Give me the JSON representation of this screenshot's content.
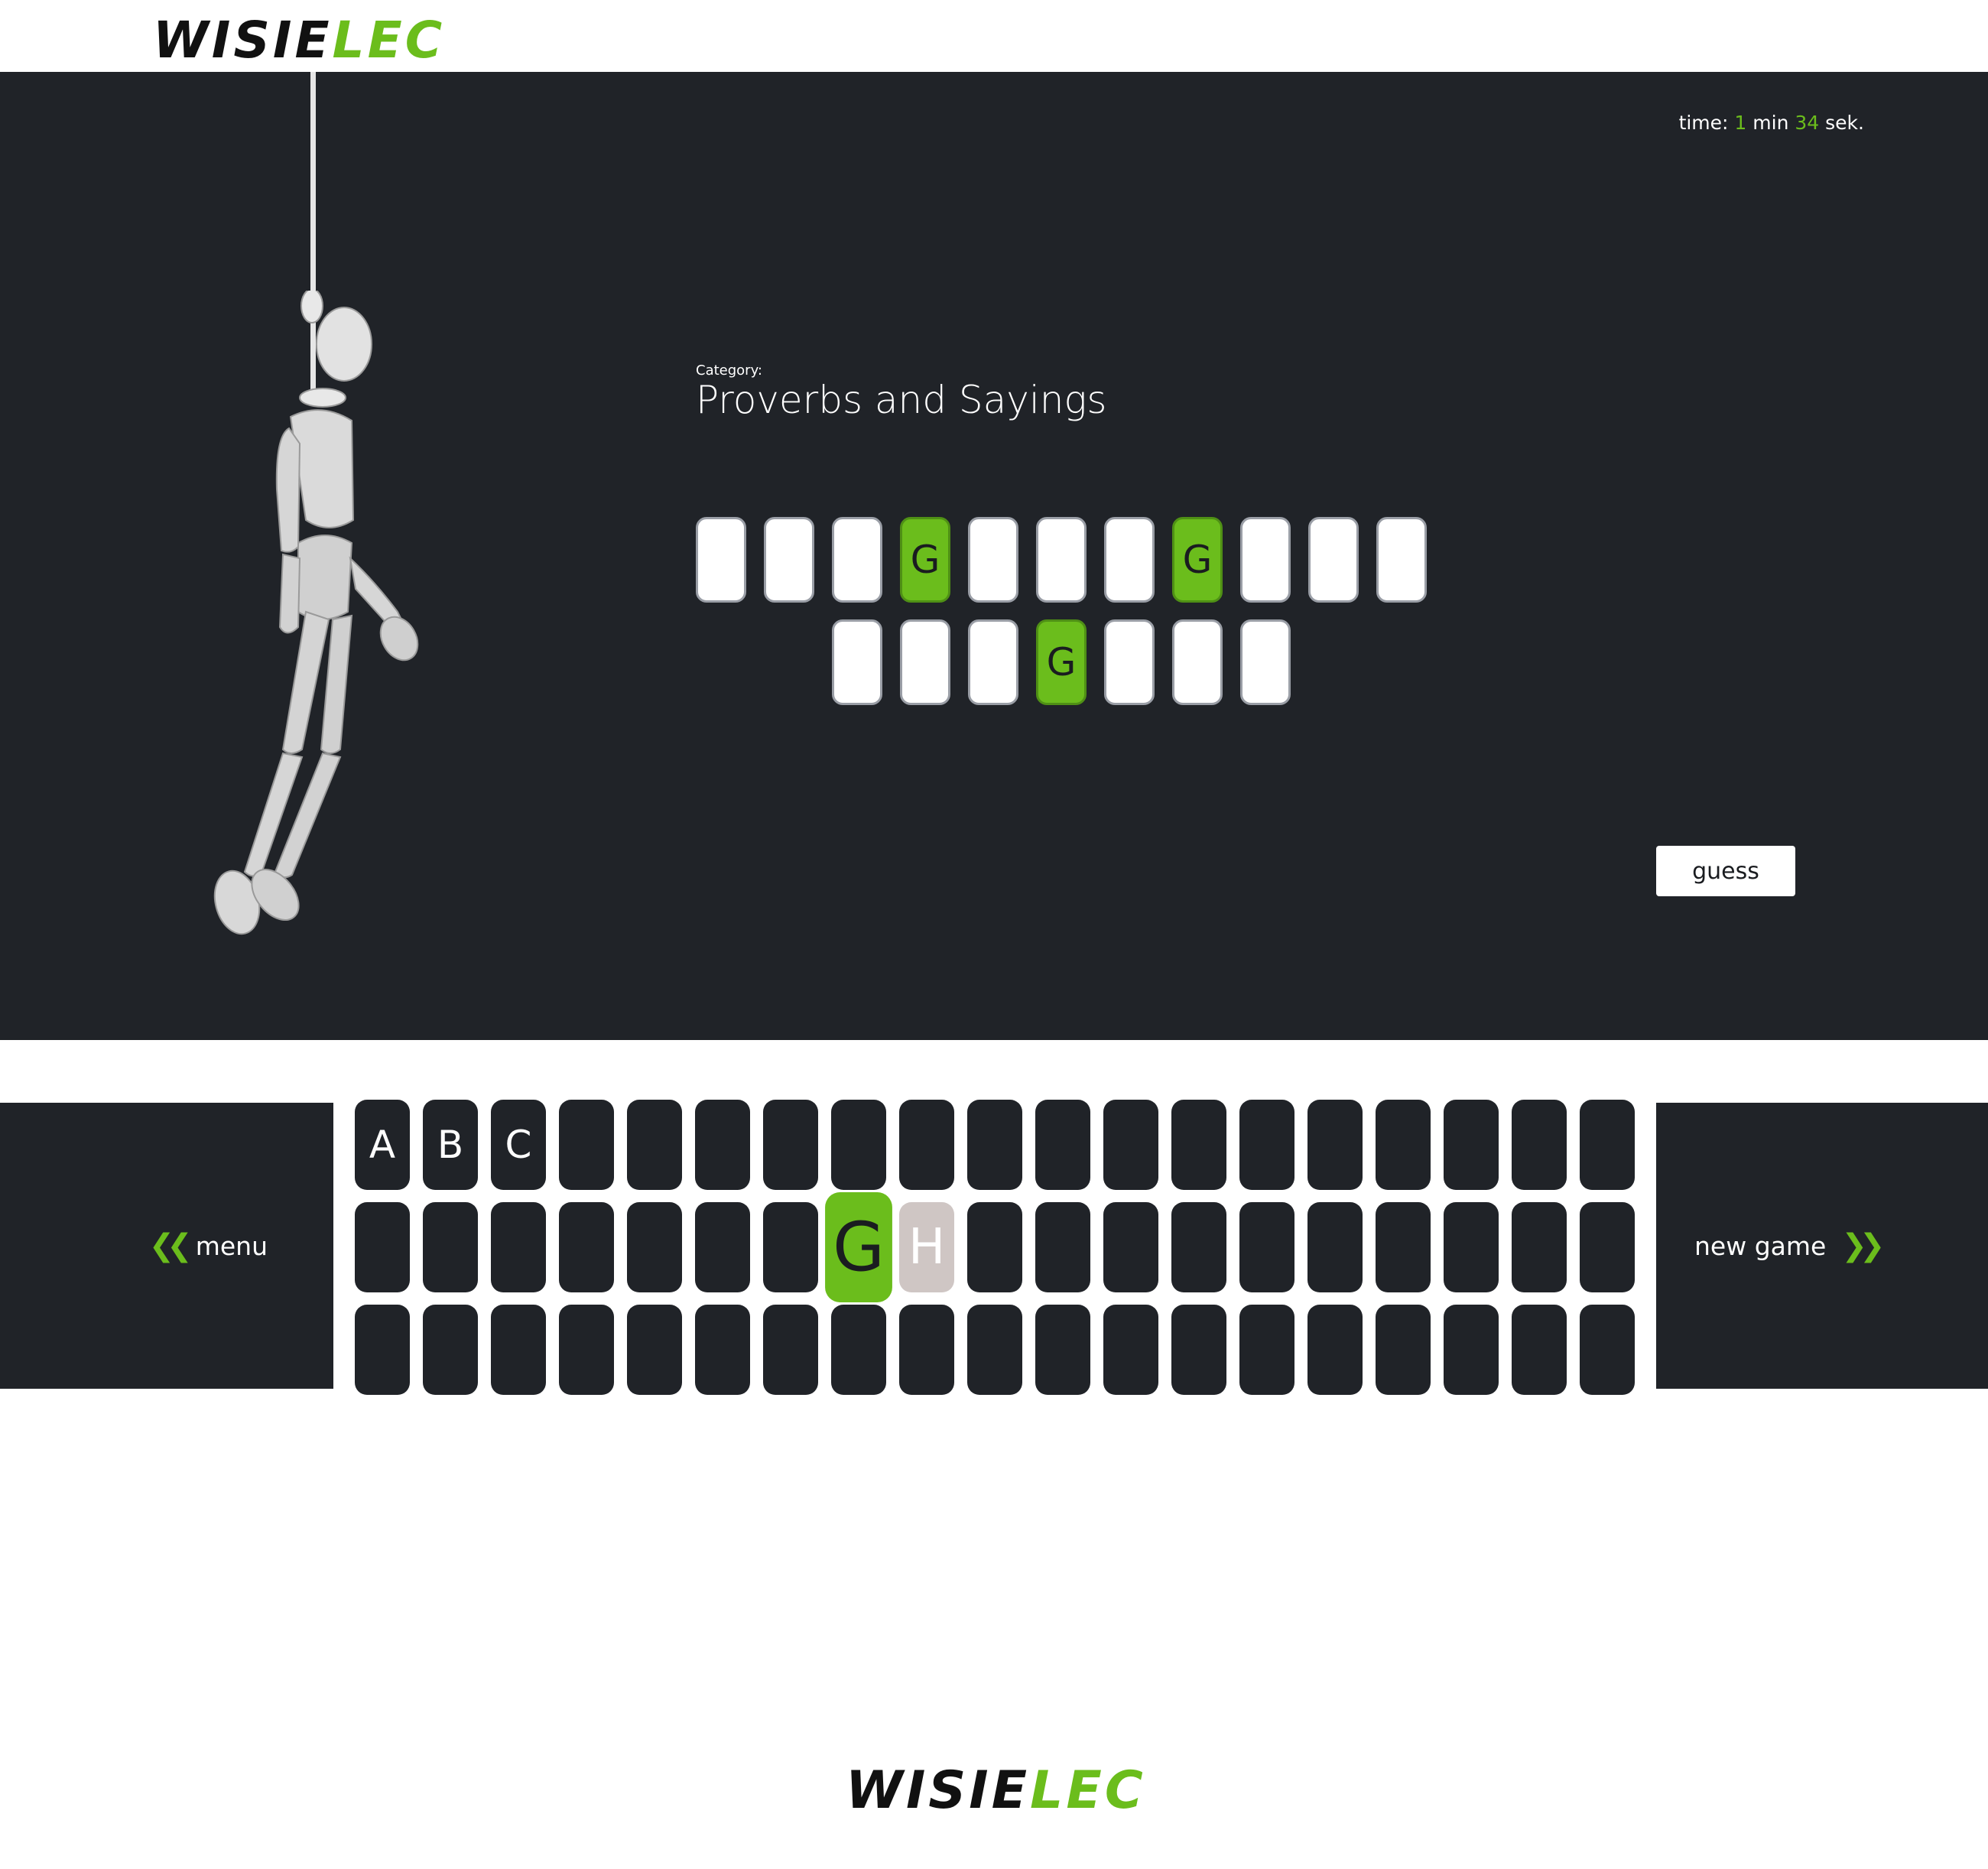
{
  "logo": {
    "part1": "WISIE",
    "part2": "LEC"
  },
  "timer": {
    "label": "time:",
    "minutes": "1",
    "min_label": "min",
    "seconds": "34",
    "sec_label": "sek."
  },
  "category": {
    "label": "Category:",
    "name": "Proverbs and Sayings"
  },
  "puzzle": {
    "rows": [
      [
        "",
        "",
        "",
        "G",
        "",
        "",
        "",
        "G",
        "",
        "",
        ""
      ],
      [
        "",
        "",
        "",
        "G",
        "",
        "",
        ""
      ]
    ]
  },
  "guess_button": "guess",
  "nav": {
    "menu": "menu",
    "new_game": "new game"
  },
  "keyboard": {
    "keys": [
      {
        "label": "A",
        "state": "normal"
      },
      {
        "label": "B",
        "state": "normal"
      },
      {
        "label": "C",
        "state": "normal"
      },
      {
        "label": "",
        "state": "normal"
      },
      {
        "label": "",
        "state": "normal"
      },
      {
        "label": "",
        "state": "normal"
      },
      {
        "label": "",
        "state": "normal"
      },
      {
        "label": "",
        "state": "normal"
      },
      {
        "label": "",
        "state": "normal"
      },
      {
        "label": "",
        "state": "normal"
      },
      {
        "label": "",
        "state": "normal"
      },
      {
        "label": "",
        "state": "normal"
      },
      {
        "label": "",
        "state": "normal"
      },
      {
        "label": "",
        "state": "normal"
      },
      {
        "label": "",
        "state": "normal"
      },
      {
        "label": "",
        "state": "normal"
      },
      {
        "label": "",
        "state": "normal"
      },
      {
        "label": "",
        "state": "normal"
      },
      {
        "label": "",
        "state": "normal"
      },
      {
        "label": "",
        "state": "normal"
      },
      {
        "label": "",
        "state": "normal"
      },
      {
        "label": "",
        "state": "normal"
      },
      {
        "label": "",
        "state": "normal"
      },
      {
        "label": "",
        "state": "normal"
      },
      {
        "label": "",
        "state": "normal"
      },
      {
        "label": "",
        "state": "normal"
      },
      {
        "label": "G",
        "state": "correct"
      },
      {
        "label": "H",
        "state": "wrong"
      },
      {
        "label": "",
        "state": "normal"
      },
      {
        "label": "",
        "state": "normal"
      },
      {
        "label": "",
        "state": "normal"
      },
      {
        "label": "",
        "state": "normal"
      },
      {
        "label": "",
        "state": "normal"
      },
      {
        "label": "",
        "state": "normal"
      },
      {
        "label": "",
        "state": "normal"
      },
      {
        "label": "",
        "state": "normal"
      },
      {
        "label": "",
        "state": "normal"
      },
      {
        "label": "",
        "state": "normal"
      },
      {
        "label": "",
        "state": "normal"
      },
      {
        "label": "",
        "state": "normal"
      },
      {
        "label": "",
        "state": "normal"
      },
      {
        "label": "",
        "state": "normal"
      },
      {
        "label": "",
        "state": "normal"
      },
      {
        "label": "",
        "state": "normal"
      },
      {
        "label": "",
        "state": "normal"
      },
      {
        "label": "",
        "state": "normal"
      },
      {
        "label": "",
        "state": "normal"
      },
      {
        "label": "",
        "state": "normal"
      },
      {
        "label": "",
        "state": "normal"
      },
      {
        "label": "",
        "state": "normal"
      },
      {
        "label": "",
        "state": "normal"
      },
      {
        "label": "",
        "state": "normal"
      },
      {
        "label": "",
        "state": "normal"
      },
      {
        "label": "",
        "state": "normal"
      },
      {
        "label": "",
        "state": "normal"
      },
      {
        "label": "",
        "state": "normal"
      },
      {
        "label": "",
        "state": "normal"
      }
    ]
  },
  "colors": {
    "accent": "#6bbd1c",
    "panel": "#202328",
    "wrong_key": "#cfc6c4"
  }
}
